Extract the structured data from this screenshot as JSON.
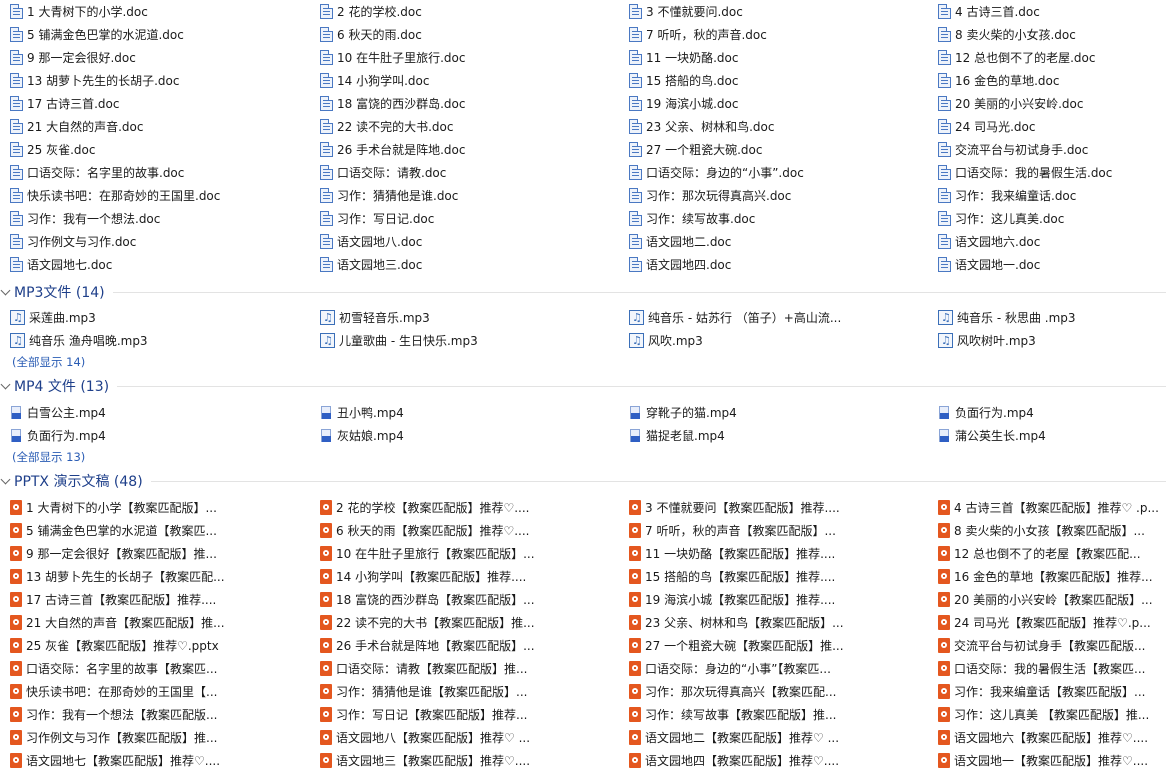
{
  "doc_rows": [
    [
      "1 大青树下的小学.doc",
      "2 花的学校.doc",
      "3 不懂就要问.doc",
      "4 古诗三首.doc"
    ],
    [
      "5 铺满金色巴掌的水泥道.doc",
      "6 秋天的雨.doc",
      "7 听听，秋的声音.doc",
      "8 卖火柴的小女孩.doc"
    ],
    [
      "9 那一定会很好.doc",
      "10 在牛肚子里旅行.doc",
      "11 一块奶酪.doc",
      "12 总也倒不了的老屋.doc"
    ],
    [
      "13 胡萝卜先生的长胡子.doc",
      "14 小狗学叫.doc",
      "15 搭船的鸟.doc",
      "16 金色的草地.doc"
    ],
    [
      "17 古诗三首.doc",
      "18 富饶的西沙群岛.doc",
      "19 海滨小城.doc",
      "20 美丽的小兴安岭.doc"
    ],
    [
      "21 大自然的声音.doc",
      "22 读不完的大书.doc",
      "23 父亲、树林和鸟.doc",
      "24 司马光.doc"
    ],
    [
      "25 灰雀.doc",
      "26 手术台就是阵地.doc",
      "27 一个粗瓷大碗.doc",
      "交流平台与初试身手.doc"
    ],
    [
      "口语交际：名字里的故事.doc",
      "口语交际：请教.doc",
      "口语交际：身边的“小事”.doc",
      "口语交际：我的暑假生活.doc"
    ],
    [
      "快乐读书吧：在那奇妙的王国里.doc",
      "习作：猜猜他是谁.doc",
      "习作：那次玩得真高兴.doc",
      "习作：我来编童话.doc"
    ],
    [
      "习作：我有一个想法.doc",
      "习作：写日记.doc",
      "习作：续写故事.doc",
      "习作：这儿真美.doc"
    ],
    [
      "习作例文与习作.doc",
      "语文园地八.doc",
      "语文园地二.doc",
      "语文园地六.doc"
    ],
    [
      "语文园地七.doc",
      "语文园地三.doc",
      "语文园地四.doc",
      "语文园地一.doc"
    ]
  ],
  "mp3_section": {
    "title": "MP3文件 (14)",
    "rows": [
      [
        "采莲曲.mp3",
        "初雪轻音乐.mp3",
        "纯音乐 - 姑苏行 （笛子）+高山流...",
        "纯音乐 - 秋思曲 .mp3"
      ],
      [
        "纯音乐 渔舟唱晚.mp3",
        "儿童歌曲 - 生日快乐.mp3",
        "风吹.mp3",
        "风吹树叶.mp3"
      ]
    ],
    "show_all": "(全部显示 14)"
  },
  "mp4_section": {
    "title": "MP4 文件 (13)",
    "rows": [
      [
        "白雪公主.mp4",
        "丑小鸭.mp4",
        "穿靴子的猫.mp4",
        "负面行为.mp4"
      ],
      [
        "负面行为.mp4",
        "灰姑娘.mp4",
        "猫捉老鼠.mp4",
        "蒲公英生长.mp4"
      ]
    ],
    "show_all": "(全部显示 13)"
  },
  "pptx_section": {
    "title": "PPTX 演示文稿 (48)",
    "rows": [
      [
        "1 大青树下的小学【教案匹配版】...",
        "2 花的学校【教案匹配版】推荐♡....",
        "3 不懂就要问【教案匹配版】推荐....",
        "4 古诗三首【教案匹配版】推荐♡ .p..."
      ],
      [
        "5 铺满金色巴掌的水泥道【教案匹...",
        "6 秋天的雨【教案匹配版】推荐♡....",
        "7 听听，秋的声音【教案匹配版】...",
        "8 卖火柴的小女孩【教案匹配版】..."
      ],
      [
        "9 那一定会很好【教案匹配版】推...",
        "10 在牛肚子里旅行【教案匹配版】...",
        "11 一块奶酪【教案匹配版】推荐....",
        "12 总也倒不了的老屋【教案匹配..."
      ],
      [
        "13 胡萝卜先生的长胡子【教案匹配...",
        "14 小狗学叫【教案匹配版】推荐....",
        "15 搭船的鸟【教案匹配版】推荐....",
        "16 金色的草地【教案匹配版】推荐..."
      ],
      [
        "17 古诗三首【教案匹配版】推荐....",
        "18 富饶的西沙群岛【教案匹配版】...",
        "19 海滨小城【教案匹配版】推荐....",
        "20 美丽的小兴安岭【教案匹配版】..."
      ],
      [
        "21 大自然的声音【教案匹配版】推...",
        "22 读不完的大书【教案匹配版】推...",
        "23 父亲、树林和鸟【教案匹配版】...",
        "24 司马光【教案匹配版】推荐♡.p..."
      ],
      [
        "25 灰雀【教案匹配版】推荐♡.pptx",
        "26 手术台就是阵地【教案匹配版】...",
        "27 一个粗瓷大碗【教案匹配版】推...",
        "交流平台与初试身手【教案匹配版..."
      ],
      [
        "口语交际：名字里的故事【教案匹...",
        "口语交际：请教【教案匹配版】推...",
        "口语交际：身边的“小事”【教案匹...",
        "口语交际：我的暑假生活【教案匹..."
      ],
      [
        "快乐读书吧：在那奇妙的王国里【...",
        "习作：猜猜他是谁【教案匹配版】...",
        "习作：那次玩得真高兴【教案匹配...",
        "习作：我来编童话【教案匹配版】..."
      ],
      [
        "习作：我有一个想法【教案匹配版...",
        "习作：写日记【教案匹配版】推荐...",
        "习作：续写故事【教案匹配版】推...",
        "习作：这儿真美 【教案匹配版】推..."
      ],
      [
        "习作例文与习作【教案匹配版】推...",
        "语文园地八【教案匹配版】推荐♡ ...",
        "语文园地二【教案匹配版】推荐♡ ...",
        "语文园地六【教案匹配版】推荐♡...."
      ],
      [
        "语文园地七【教案匹配版】推荐♡....",
        "语文园地三【教案匹配版】推荐♡....",
        "语文园地四【教案匹配版】推荐♡....",
        "语文园地一【教案匹配版】推荐♡...."
      ]
    ]
  },
  "icons": {
    "doc": "word-doc-icon",
    "mp3": "audio-file-icon",
    "mp4": "video-file-icon",
    "pptx": "powerpoint-file-icon",
    "section_toggle": "chevron-down-icon"
  },
  "colors": {
    "section_title": "#1e3f8a",
    "show_all_link": "#2a5cb4",
    "doc_icon": "#4a78c2",
    "ppt_icon": "#e4571f",
    "video_icon": "#2f5fc4"
  }
}
